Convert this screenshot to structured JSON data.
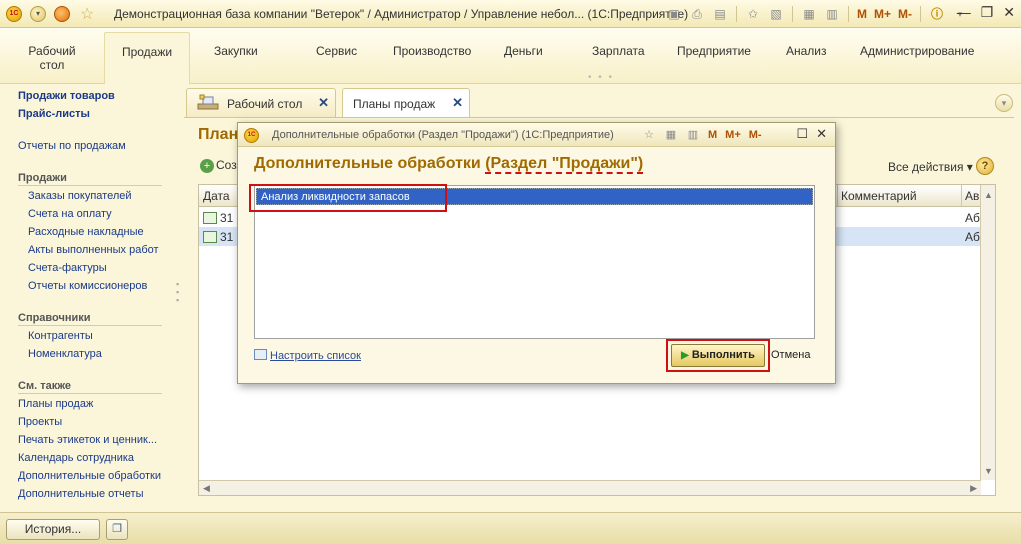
{
  "window": {
    "title": "Демонстрационная база компании \"Ветерок\" / Администратор / Управление небол... (1С:Предприятие)",
    "toolbar_m": [
      "M",
      "M+",
      "M-"
    ]
  },
  "sections": [
    {
      "label": "Рабочий стол"
    },
    {
      "label": "Продажи"
    },
    {
      "label": "Закупки"
    },
    {
      "label": "Сервис"
    },
    {
      "label": "Производство"
    },
    {
      "label": "Деньги"
    },
    {
      "label": "Зарплата"
    },
    {
      "label": "Предприятие"
    },
    {
      "label": "Анализ"
    },
    {
      "label": "Администрирование"
    }
  ],
  "nav": {
    "top_links": [
      "Продажи товаров",
      "Прайс-листы"
    ],
    "reports_link": "Отчеты по продажам",
    "sales_header": "Продажи",
    "sales_items": [
      "Заказы покупателей",
      "Счета на оплату",
      "Расходные накладные",
      "Акты выполненных работ",
      "Счета-фактуры",
      "Отчеты комиссионеров"
    ],
    "refs_header": "Справочники",
    "refs_items": [
      "Контрагенты",
      "Номенклатура"
    ],
    "seealso_header": "См. также",
    "seealso_items": [
      "Планы продаж",
      "Проекты",
      "Печать этикеток и ценник...",
      "Календарь сотрудника",
      "Дополнительные обработки",
      "Дополнительные отчеты"
    ]
  },
  "tabs": [
    {
      "label": "Рабочий стол"
    },
    {
      "label": "Планы продаж"
    }
  ],
  "form": {
    "title_partial": "План",
    "create_partial": "Соз",
    "all_actions": "Все действия ▾",
    "help": "?",
    "columns": {
      "date": "Дата",
      "comment": "Комментарий",
      "author_partial": "Ав"
    },
    "rows": [
      {
        "date": "31",
        "author": "Аб"
      },
      {
        "date": "31",
        "author": "Аб"
      }
    ]
  },
  "bottom": {
    "history": "История..."
  },
  "modal": {
    "title": "Дополнительные обработки (Раздел \"Продажи\")  (1С:Предприятие)",
    "toolbar_m": [
      "M",
      "M+",
      "M-"
    ],
    "heading_main": "Дополнительные обработки ",
    "heading_underlined": "(Раздел \"Продажи\")",
    "list_item": "Анализ ликвидности запасов",
    "configure": "Настроить список",
    "execute": "Выполнить",
    "cancel": "Отмена"
  },
  "colors": {
    "accent": "#a06a00",
    "link": "#1a3a8a",
    "selection": "#3163c6",
    "highlight_box": "#d01010"
  }
}
